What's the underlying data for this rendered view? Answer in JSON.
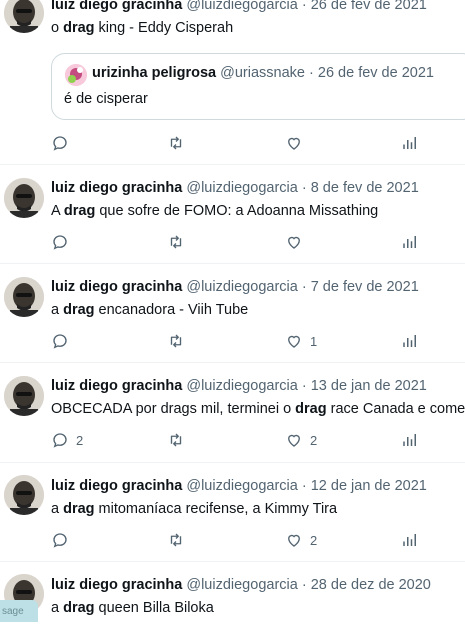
{
  "tweets": [
    {
      "name": "luiz diego gracinha",
      "handle": "@luizdiegogarcia",
      "date": "26 de fev de 2021",
      "text": {
        "pre": "o ",
        "bold": "drag",
        "post": " king - Eddy Cisperah"
      },
      "quote": {
        "name": "urizinha peligrosa",
        "handle": "@uriassnake",
        "date": "26 de fev de 2021",
        "text": "é de cisperar"
      },
      "counts": {
        "reply": "",
        "retweet": "",
        "like": ""
      }
    },
    {
      "name": "luiz diego gracinha",
      "handle": "@luizdiegogarcia",
      "date": "8 de fev de 2021",
      "text": {
        "pre": "A ",
        "bold": "drag",
        "post": " que sofre de FOMO: a Adoanna Missathing"
      },
      "counts": {
        "reply": "",
        "retweet": "",
        "like": ""
      }
    },
    {
      "name": "luiz diego gracinha",
      "handle": "@luizdiegogarcia",
      "date": "7 de fev de 2021",
      "text": {
        "pre": "a ",
        "bold": "drag",
        "post": " encanadora - Viih Tube"
      },
      "counts": {
        "reply": "",
        "retweet": "",
        "like": "1"
      }
    },
    {
      "name": "luiz diego gracinha",
      "handle": "@luizdiegogarcia",
      "date": "13 de jan de 2021",
      "text": {
        "pre": "OBCECADA por drags mil, terminei o ",
        "bold": "drag",
        "post": " race Canada e come"
      },
      "counts": {
        "reply": "2",
        "retweet": "",
        "like": "2"
      }
    },
    {
      "name": "luiz diego gracinha",
      "handle": "@luizdiegogarcia",
      "date": "12 de jan de 2021",
      "text": {
        "pre": "a ",
        "bold": "drag",
        "post": " mitomaníaca recifense, a Kimmy Tira"
      },
      "counts": {
        "reply": "",
        "retweet": "",
        "like": "2"
      }
    },
    {
      "name": "luiz diego gracinha",
      "handle": "@luizdiegogarcia",
      "date": "28 de dez de 2020",
      "text": {
        "pre": "a ",
        "bold": "drag",
        "post": " queen Billa Biloka"
      }
    }
  ],
  "chip_label": "sage",
  "colors": {
    "text": "#0f1419",
    "secondary": "#536471",
    "border": "#eff3f4"
  },
  "icons": [
    "reply-icon",
    "retweet-icon",
    "like-icon",
    "analytics-icon"
  ]
}
